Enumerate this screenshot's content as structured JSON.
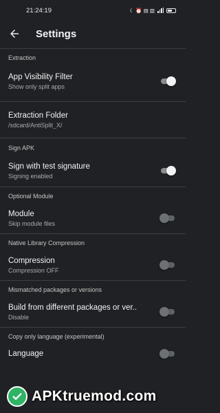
{
  "status_bar": {
    "time": "21:24:19",
    "indicators": "☾ ⏰ ▤ ▥",
    "battery": "68"
  },
  "app_bar": {
    "title": "Settings",
    "back_icon": "arrow-left-icon"
  },
  "sections": {
    "extraction": {
      "header": "Extraction",
      "visibility_filter": {
        "title": "App Visibility Filter",
        "subtitle": "Show only split apps",
        "enabled": true
      },
      "extraction_folder": {
        "title": "Extraction Folder",
        "subtitle": "/sdcard/AntiSplit_X/"
      }
    },
    "sign_apk": {
      "header": "Sign APK",
      "test_signature": {
        "title": "Sign with test signature",
        "subtitle": "Signing enabled",
        "enabled": true
      }
    },
    "optional_module": {
      "header": "Optional Module",
      "module": {
        "title": "Module",
        "subtitle": "Skip module files",
        "enabled": false
      }
    },
    "native_compression": {
      "header": "Native Library Compression",
      "compression": {
        "title": "Compression",
        "subtitle": "Compression OFF",
        "enabled": false
      }
    },
    "mismatched": {
      "header": "Mismatched packages or versions",
      "build_different": {
        "title": "Build from different packages or ver..",
        "subtitle": "Disable",
        "enabled": false
      }
    },
    "copy_language": {
      "header": "Copy only language (experimental)",
      "language": {
        "title": "Language",
        "enabled": false
      }
    }
  },
  "watermark": {
    "text": "APKtruemod.com",
    "colors": {
      "badge": "#2fb365"
    }
  },
  "colors": {
    "background": "#202124",
    "divider": "#3c4043",
    "toggle_on_thumb": "#f1f3f4",
    "toggle_off_thumb": "#6e7174"
  }
}
